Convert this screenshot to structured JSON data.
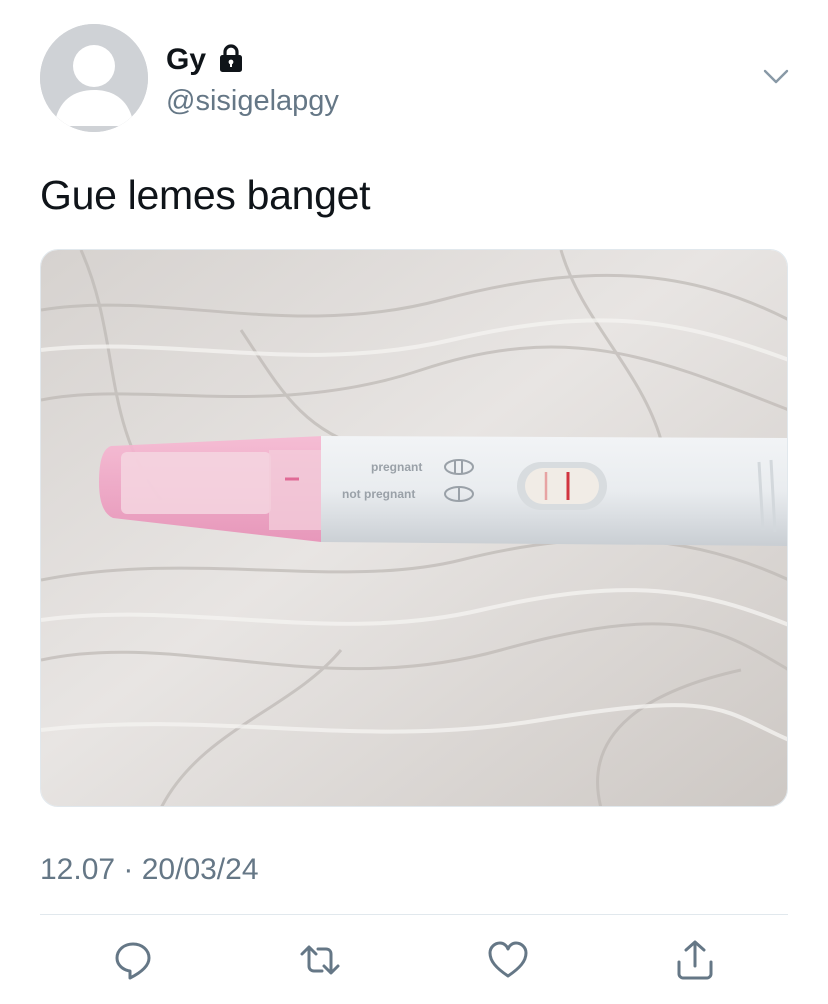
{
  "user": {
    "display_name": "Gy",
    "handle": "@sisigelapgy",
    "protected_icon": "lock-icon",
    "avatar_icon": "default-profile-icon"
  },
  "header": {
    "more_icon": "chevron-down-icon"
  },
  "tweet": {
    "text": "Gue lemes banget",
    "media": {
      "kind": "photo",
      "test_labels": [
        "pregnant",
        "not pregnant"
      ]
    },
    "timestamp": "12.07 · 20/03/24"
  },
  "actions": [
    {
      "name": "reply",
      "icon": "reply-icon"
    },
    {
      "name": "retweet",
      "icon": "retweet-icon"
    },
    {
      "name": "like",
      "icon": "heart-icon"
    },
    {
      "name": "share",
      "icon": "share-icon"
    }
  ],
  "colors": {
    "text_primary": "#0f1419",
    "text_secondary": "#657786",
    "icon": "#657786",
    "divider": "#e1e8ed",
    "avatar_bg": "#cfd2d6"
  }
}
